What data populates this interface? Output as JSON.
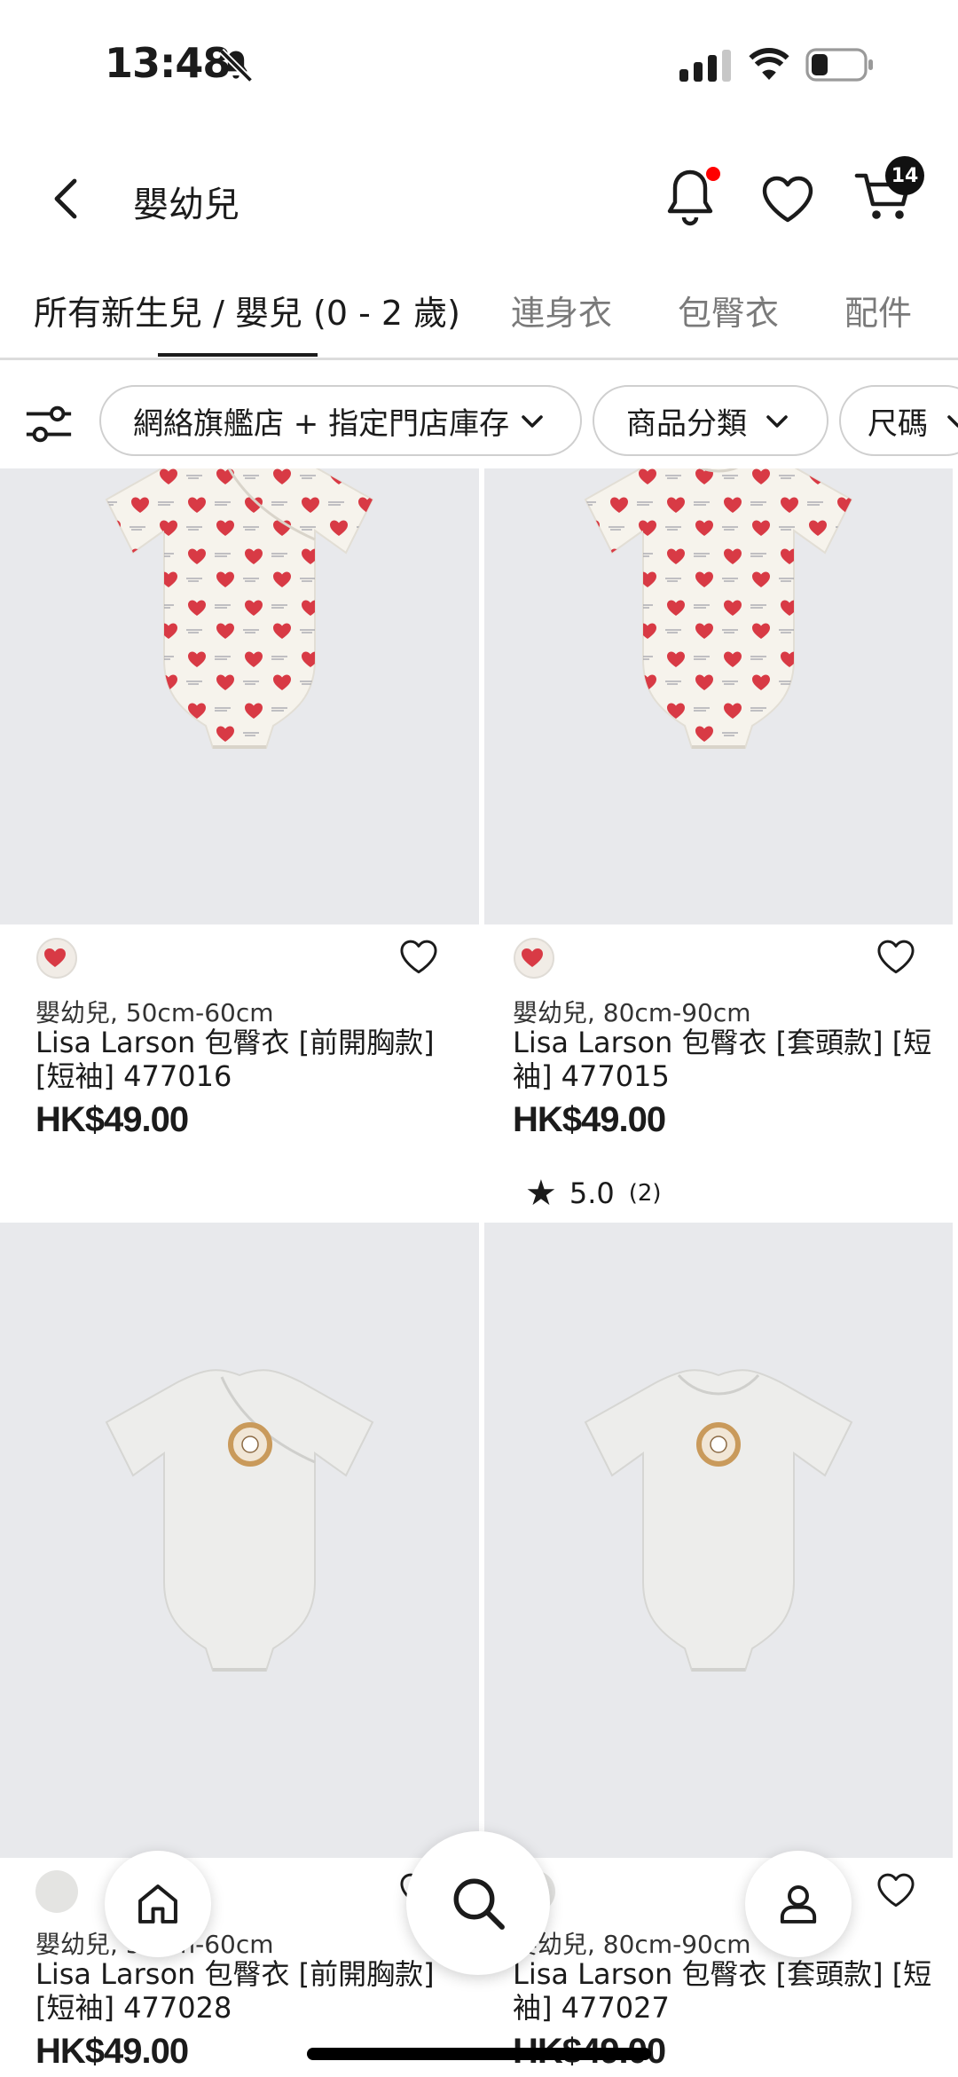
{
  "status_bar": {
    "time": "13:48"
  },
  "header": {
    "title": "嬰幼兒",
    "cart_count": "14"
  },
  "tabs": [
    {
      "label": "所有新生兒 / 嬰兒 (0 - 2 歲)"
    },
    {
      "label": "連身衣"
    },
    {
      "label": "包臀衣"
    },
    {
      "label": "配件"
    }
  ],
  "filters": [
    {
      "label": "網絡旗艦店 + 指定門店庫存"
    },
    {
      "label": "商品分類"
    },
    {
      "label": "尺碼"
    }
  ],
  "products": [
    {
      "meta": "嬰幼兒, 50cm-60cm",
      "name": "Lisa Larson 包臀衣 [前開胸款] [短袖] 477016",
      "price": "HK$49.00"
    },
    {
      "meta": "嬰幼兒, 80cm-90cm",
      "name": "Lisa Larson 包臀衣 [套頭款] [短袖] 477015",
      "price": "HK$49.00",
      "rating": "5.0",
      "reviews": "(2)"
    },
    {
      "meta": "嬰幼兒, 50cm-60cm",
      "name": "Lisa Larson 包臀衣 [前開胸款] [短袖] 477028",
      "price": "HK$49.00"
    },
    {
      "meta": "嬰幼兒, 80cm-90cm",
      "name": "Lisa Larson 包臀衣 [套頭款] [短袖] 477027",
      "price": "HK$49.00"
    }
  ],
  "colors": {
    "accent": "#1b1b1b",
    "notification": "#ff0000",
    "image_bg": "#e8e9ec",
    "heart_print": "#d83a45"
  },
  "icons": [
    "bell-slash-icon",
    "signal-icon",
    "wifi-icon",
    "battery-icon",
    "back-chevron-icon",
    "bell-icon",
    "heart-icon",
    "cart-icon",
    "filter-sliders-icon",
    "chevron-down-icon",
    "star-icon",
    "home-icon",
    "search-icon",
    "account-icon"
  ]
}
